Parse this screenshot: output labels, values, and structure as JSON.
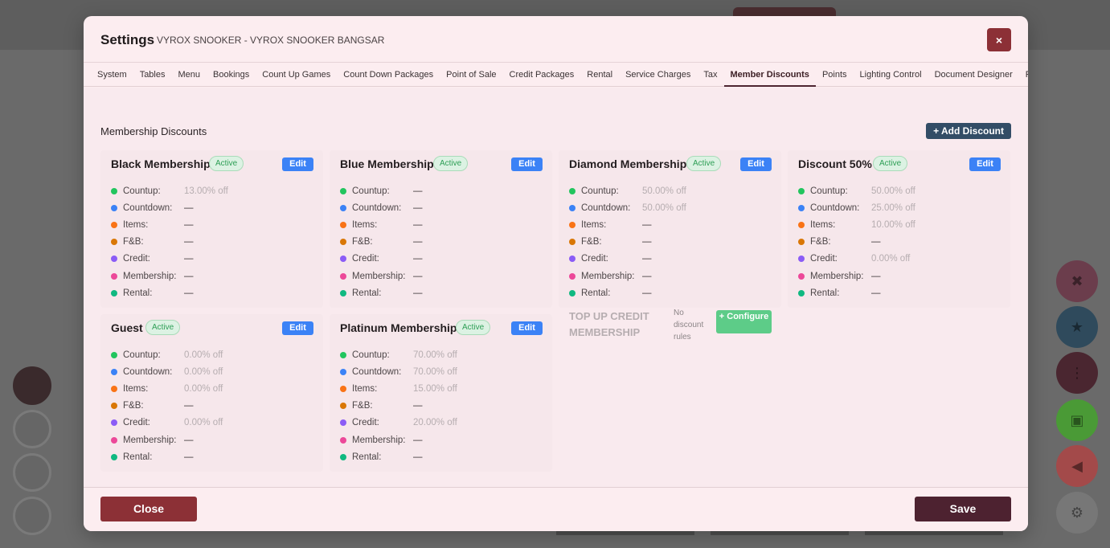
{
  "header": {
    "title": "Settings",
    "subtitle": "VYROX SNOOKER - VYROX SNOOKER BANGSAR",
    "close_icon": "close-icon",
    "close_symbol": "×"
  },
  "tabs": [
    {
      "label": "System"
    },
    {
      "label": "Tables"
    },
    {
      "label": "Menu"
    },
    {
      "label": "Bookings"
    },
    {
      "label": "Count Up Games"
    },
    {
      "label": "Count Down Packages"
    },
    {
      "label": "Point of Sale"
    },
    {
      "label": "Credit Packages"
    },
    {
      "label": "Rental"
    },
    {
      "label": "Service Charges"
    },
    {
      "label": "Tax"
    },
    {
      "label": "Member Discounts",
      "active": true
    },
    {
      "label": "Points"
    },
    {
      "label": "Lighting Control"
    },
    {
      "label": "Document Designer"
    },
    {
      "label": "Printers"
    }
  ],
  "section": {
    "title": "Membership Discounts",
    "add_button": "+ Add Discount"
  },
  "rule_labels": {
    "countup": "Countup:",
    "countdown": "Countdown:",
    "items": "Items:",
    "fnb": "F&B:",
    "credit": "Credit:",
    "membership": "Membership:",
    "rental": "Rental:"
  },
  "rule_colors": {
    "countup": "#22c55e",
    "countdown": "#3b82f6",
    "items": "#f97316",
    "fnb": "#d97706",
    "credit": "#8b5cf6",
    "membership": "#ec4899",
    "rental": "#10b981"
  },
  "cards": [
    {
      "name": "Black Membership",
      "status": "Active",
      "edit": "Edit",
      "values": {
        "countup": "13.00% off",
        "countdown": "—",
        "items": "—",
        "fnb": "—",
        "credit": "—",
        "membership": "—",
        "rental": "—"
      }
    },
    {
      "name": "Blue Membership",
      "status": "Active",
      "edit": "Edit",
      "values": {
        "countup": "—",
        "countdown": "—",
        "items": "—",
        "fnb": "—",
        "credit": "—",
        "membership": "—",
        "rental": "—"
      }
    },
    {
      "name": "Diamond Membership",
      "status": "Active",
      "edit": "Edit",
      "values": {
        "countup": "50.00% off",
        "countdown": "50.00% off",
        "items": "—",
        "fnb": "—",
        "credit": "—",
        "membership": "—",
        "rental": "—"
      }
    },
    {
      "name": "Discount 50%",
      "status": "Active",
      "edit": "Edit",
      "values": {
        "countup": "50.00% off",
        "countdown": "25.00% off",
        "items": "10.00% off",
        "fnb": "—",
        "credit": "0.00% off",
        "membership": "—",
        "rental": "—"
      }
    },
    {
      "name": "Guest",
      "status": "Active",
      "edit": "Edit",
      "values": {
        "countup": "0.00% off",
        "countdown": "0.00% off",
        "items": "0.00% off",
        "fnb": "—",
        "credit": "0.00% off",
        "membership": "—",
        "rental": "—"
      }
    },
    {
      "name": "Platinum Membership",
      "status": "Active",
      "edit": "Edit",
      "values": {
        "countup": "70.00% off",
        "countdown": "70.00% off",
        "items": "15.00% off",
        "fnb": "—",
        "credit": "20.00% off",
        "membership": "—",
        "rental": "—"
      }
    }
  ],
  "empty_card": {
    "name": "TOP UP CREDIT MEMBERSHIP",
    "note": "No discount rules",
    "configure": "+ Configure"
  },
  "footer": {
    "close": "Close",
    "save": "Save"
  }
}
